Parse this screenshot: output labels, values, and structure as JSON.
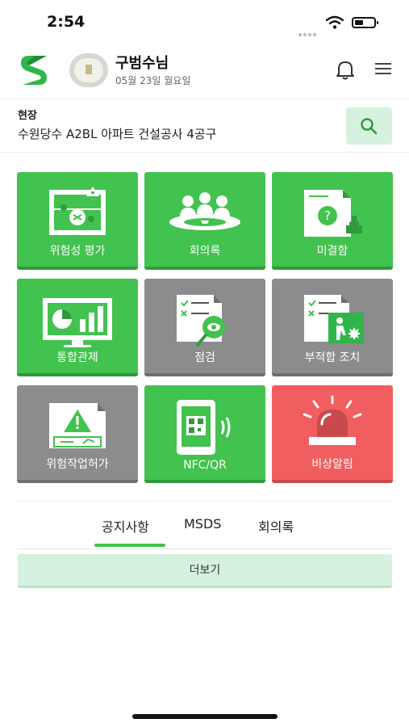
{
  "status_bar": {
    "time": "2:54"
  },
  "header": {
    "user_name": "구범수님",
    "date": "05월 23일  월요일"
  },
  "site": {
    "label": "현장",
    "name": "수원당수 A2BL 아파트 건설공사 4공구"
  },
  "tiles": [
    {
      "label": "위험성 평가",
      "icon": "risk-assessment-icon",
      "color": "#42c24e"
    },
    {
      "label": "회의록",
      "icon": "meeting-icon",
      "color": "#42c24e"
    },
    {
      "label": "미결함",
      "icon": "pending-box-icon",
      "color": "#42c24e"
    },
    {
      "label": "통합관제",
      "icon": "monitor-chart-icon",
      "color": "#42c24e"
    },
    {
      "label": "점검",
      "icon": "inspection-icon",
      "color": "#8c8c8c"
    },
    {
      "label": "부적합 조치",
      "icon": "nonconformity-icon",
      "color": "#8c8c8c"
    },
    {
      "label": "위험작업허가",
      "icon": "warning-permit-icon",
      "color": "#8c8c8c"
    },
    {
      "label": "NFC/QR",
      "icon": "nfc-qr-icon",
      "color": "#42c24e"
    },
    {
      "label": "비상알림",
      "icon": "siren-icon",
      "color": "#f15e60"
    }
  ],
  "tabs": [
    {
      "label": "공지사항",
      "active": true
    },
    {
      "label": "MSDS",
      "active": false
    },
    {
      "label": "회의록",
      "active": false
    }
  ],
  "more_button": "더보기",
  "colors": {
    "accent": "#42c24e",
    "accent_light": "#d4f2df",
    "gray_tile": "#8c8c8c",
    "alert": "#f15e60"
  }
}
